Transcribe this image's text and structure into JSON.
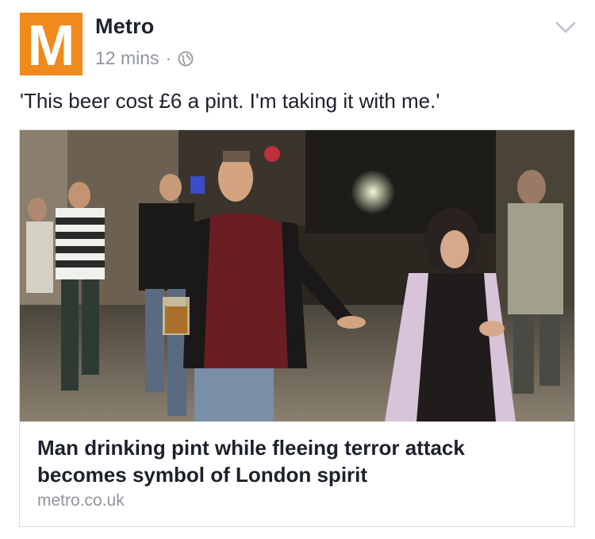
{
  "post": {
    "page_name": "Metro",
    "avatar_letter": "M",
    "timestamp": "12 mins",
    "separator": "·",
    "privacy_icon": "globe-icon",
    "menu_icon": "chevron-down-icon",
    "text": "'This beer cost £6 a pint. I'm taking it with me.'"
  },
  "link": {
    "title": "Man drinking pint while fleeing terror attack becomes symbol of London spirit",
    "domain": "metro.co.uk"
  },
  "colors": {
    "brand_orange": "#f08a1c",
    "text_primary": "#1d2129",
    "text_secondary": "#90949c",
    "card_border": "#d6d9dd"
  }
}
